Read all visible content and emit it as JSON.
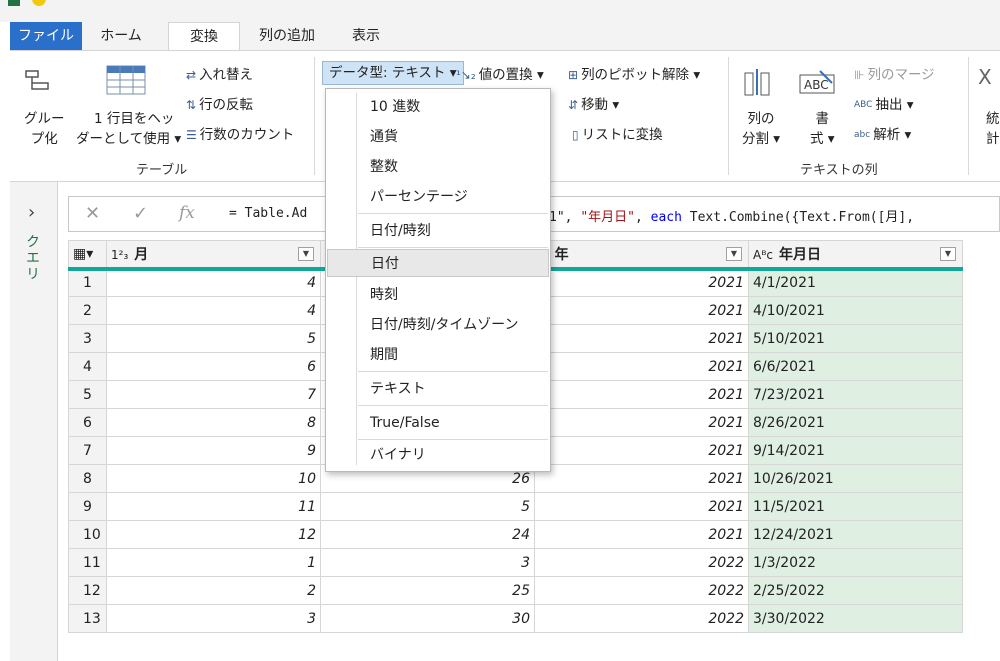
{
  "ribbon_tabs": [
    "ファイル",
    "ホーム",
    "変換",
    "列の追加",
    "表示"
  ],
  "ribbon": {
    "group_table_label": "テーブル",
    "group_text_label": "テキストの列",
    "group_by": [
      "グルー",
      "プ化"
    ],
    "use_first_row": [
      "1 行目をヘッ",
      "ダーとして使用 ▾"
    ],
    "transpose": "入れ替え",
    "reverse_rows": "行の反転",
    "count_rows": "行数のカウント",
    "data_type": "データ型: テキスト ▾",
    "replace_values": "値の置換 ▾",
    "unpivot": "列のピボット解除 ▾",
    "move": "移動 ▾",
    "convert_to_list": "リストに変換",
    "split_column": [
      "列の",
      "分割 ▾"
    ],
    "format": [
      "書",
      "式 ▾"
    ],
    "merge_columns": "列のマージ",
    "extract": "抽出 ▾",
    "parse": "解析 ▾",
    "partial_right": [
      "統",
      "計"
    ]
  },
  "left_panel": {
    "label": "クエリ"
  },
  "formula_bar": {
    "fx": "fx",
    "formula_left": "= Table.Ad",
    "formula_right_prefix": "1\", ",
    "formula_right_str": "\"年月日\"",
    "formula_right_sep": ", ",
    "formula_right_kw": "each",
    "formula_right_suffix": " Text.Combine({Text.From([月],"
  },
  "menu_items": [
    {
      "label": "10 進数"
    },
    {
      "label": "通貨"
    },
    {
      "label": "整数"
    },
    {
      "label": "パーセンテージ"
    },
    {
      "label": "日付/時刻"
    },
    {
      "label": "日付"
    },
    {
      "label": "時刻"
    },
    {
      "label": "日付/時刻/タイムゾーン"
    },
    {
      "label": "期間"
    },
    {
      "label": "テキスト"
    },
    {
      "label": "True/False"
    },
    {
      "label": "バイナリ"
    }
  ],
  "menu_highlighted": "日付",
  "columns": [
    {
      "type": "1²₃",
      "name": "月"
    },
    {
      "type": "",
      "name": ""
    },
    {
      "type": "²₃",
      "name": "年"
    },
    {
      "type": "Aᴮc",
      "name": "年月日"
    }
  ],
  "partial_header_fragment": "l 1",
  "rows": [
    {
      "n": "1",
      "month": "4",
      "day": "",
      "year": "2021",
      "date": "4/1/2021"
    },
    {
      "n": "2",
      "month": "4",
      "day": "",
      "year": "2021",
      "date": "4/10/2021"
    },
    {
      "n": "3",
      "month": "5",
      "day": "",
      "year": "2021",
      "date": "5/10/2021"
    },
    {
      "n": "4",
      "month": "6",
      "day": "",
      "year": "2021",
      "date": "6/6/2021"
    },
    {
      "n": "5",
      "month": "7",
      "day": "",
      "year": "2021",
      "date": "7/23/2021"
    },
    {
      "n": "6",
      "month": "8",
      "day": "",
      "year": "2021",
      "date": "8/26/2021"
    },
    {
      "n": "7",
      "month": "9",
      "day": "",
      "year": "2021",
      "date": "9/14/2021"
    },
    {
      "n": "8",
      "month": "10",
      "day": "26",
      "year": "2021",
      "date": "10/26/2021"
    },
    {
      "n": "9",
      "month": "11",
      "day": "5",
      "year": "2021",
      "date": "11/5/2021"
    },
    {
      "n": "10",
      "month": "12",
      "day": "24",
      "year": "2021",
      "date": "12/24/2021"
    },
    {
      "n": "11",
      "month": "1",
      "day": "3",
      "year": "2022",
      "date": "1/3/2022"
    },
    {
      "n": "12",
      "month": "2",
      "day": "25",
      "year": "2022",
      "date": "2/25/2022"
    },
    {
      "n": "13",
      "month": "3",
      "day": "30",
      "year": "2022",
      "date": "3/30/2022"
    }
  ],
  "colors": {
    "file_tab": "#2a6fc9",
    "header_accent": "#0fa89b",
    "text_column_bg": "#dff0e3",
    "query_label": "#217346"
  }
}
